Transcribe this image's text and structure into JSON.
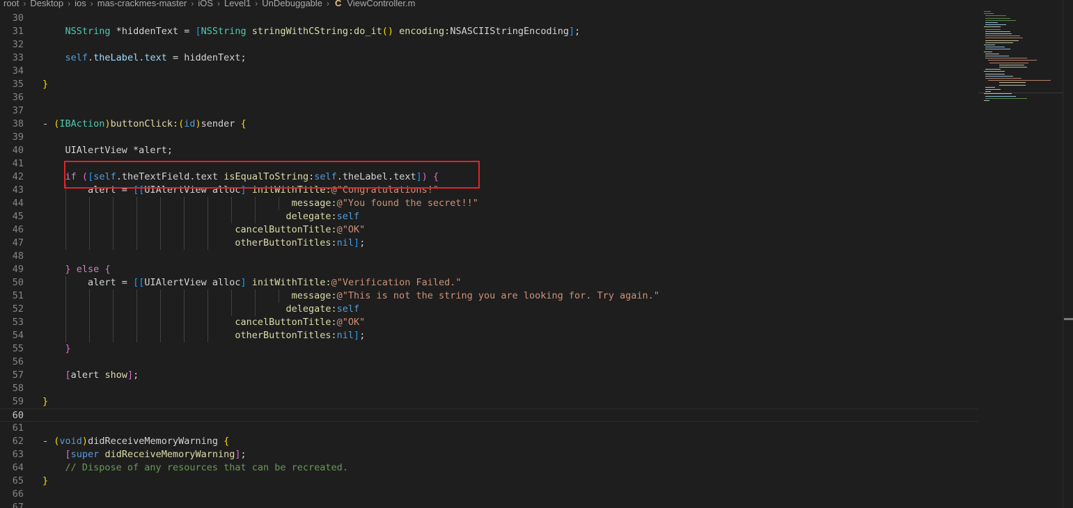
{
  "breadcrumb": {
    "items": [
      "root",
      "Desktop",
      "ios",
      "mas-crackmes-master",
      "iOS",
      "Level1",
      "UnDebuggable"
    ],
    "file_icon": "C",
    "file_name": "ViewController.m"
  },
  "editor": {
    "active_line": 60,
    "highlighted_lines": [
      42
    ],
    "lines": [
      {
        "n": 30,
        "tokens": []
      },
      {
        "n": 31,
        "tokens": [
          [
            "    ",
            ""
          ],
          [
            "NSString",
            "tk-type"
          ],
          [
            " *",
            ""
          ],
          [
            "hiddenText",
            ""
          ],
          [
            " = ",
            ""
          ],
          [
            "[",
            "tk-brk3"
          ],
          [
            "NSString",
            "tk-type"
          ],
          [
            " ",
            ""
          ],
          [
            "stringWithCString:",
            "tk-fn"
          ],
          [
            "do_it",
            "tk-fn"
          ],
          [
            "()",
            "tk-brk1"
          ],
          [
            " ",
            ""
          ],
          [
            "encoding:",
            "tk-fn"
          ],
          [
            "NSASCIIStringEncoding",
            ""
          ],
          [
            "]",
            "tk-brk3"
          ],
          [
            ";",
            ""
          ]
        ]
      },
      {
        "n": 32,
        "tokens": []
      },
      {
        "n": 33,
        "tokens": [
          [
            "    ",
            ""
          ],
          [
            "self",
            "tk-blue"
          ],
          [
            ".",
            ""
          ],
          [
            "theLabel",
            "tk-var"
          ],
          [
            ".",
            ""
          ],
          [
            "text",
            "tk-var"
          ],
          [
            " = hiddenText;",
            ""
          ]
        ]
      },
      {
        "n": 34,
        "tokens": []
      },
      {
        "n": 35,
        "tokens": [
          [
            "}",
            "tk-brk1"
          ]
        ]
      },
      {
        "n": 36,
        "tokens": []
      },
      {
        "n": 37,
        "tokens": []
      },
      {
        "n": 38,
        "tokens": [
          [
            "- ",
            ""
          ],
          [
            "(",
            "tk-brk1"
          ],
          [
            "IBAction",
            "tk-type"
          ],
          [
            ")",
            "tk-brk1"
          ],
          [
            "buttonClick:",
            "tk-fn"
          ],
          [
            "(",
            "tk-brk1"
          ],
          [
            "id",
            "tk-blue"
          ],
          [
            ")",
            "tk-brk1"
          ],
          [
            "sender",
            ""
          ],
          [
            " ",
            ""
          ],
          [
            "{",
            "tk-brk1"
          ]
        ]
      },
      {
        "n": 39,
        "tokens": []
      },
      {
        "n": 40,
        "tokens": [
          [
            "    ",
            ""
          ],
          [
            "UIAlertView",
            ""
          ],
          [
            " *alert;",
            ""
          ]
        ]
      },
      {
        "n": 41,
        "tokens": []
      },
      {
        "n": 42,
        "tokens": [
          [
            "    ",
            ""
          ],
          [
            "if",
            "tk-kw"
          ],
          [
            " ",
            ""
          ],
          [
            "(",
            "tk-brk2"
          ],
          [
            "[",
            "tk-brk3"
          ],
          [
            "self",
            "tk-blue"
          ],
          [
            ".",
            ""
          ],
          [
            "theTextField",
            ""
          ],
          [
            ".",
            ""
          ],
          [
            "text",
            ""
          ],
          [
            " ",
            ""
          ],
          [
            "isEqualToString:",
            "tk-fn"
          ],
          [
            "self",
            "tk-blue"
          ],
          [
            ".",
            ""
          ],
          [
            "theLabel",
            ""
          ],
          [
            ".",
            ""
          ],
          [
            "text",
            ""
          ],
          [
            "]",
            "tk-brk3"
          ],
          [
            ")",
            "tk-brk2"
          ],
          [
            " ",
            ""
          ],
          [
            "{",
            "tk-brk2"
          ]
        ]
      },
      {
        "n": 43,
        "tokens": [
          [
            "        ",
            ""
          ],
          [
            "alert",
            ""
          ],
          [
            " = ",
            ""
          ],
          [
            "[[",
            "tk-brk3"
          ],
          [
            "UIAlertView",
            ""
          ],
          [
            " alloc",
            ""
          ],
          [
            "]",
            "tk-brk3"
          ],
          [
            " ",
            ""
          ],
          [
            "initWithTitle:",
            "tk-fn"
          ],
          [
            "@\"Congratulations!\"",
            "tk-str"
          ]
        ]
      },
      {
        "n": 44,
        "tokens": [
          [
            "                                            ",
            ""
          ],
          [
            "message:",
            "tk-fn"
          ],
          [
            "@\"You found the secret!!\"",
            "tk-str"
          ]
        ]
      },
      {
        "n": 45,
        "tokens": [
          [
            "                                           ",
            ""
          ],
          [
            "delegate:",
            "tk-fn"
          ],
          [
            "self",
            "tk-blue"
          ]
        ]
      },
      {
        "n": 46,
        "tokens": [
          [
            "                                  ",
            ""
          ],
          [
            "cancelButtonTitle:",
            "tk-fn"
          ],
          [
            "@\"OK\"",
            "tk-str"
          ]
        ]
      },
      {
        "n": 47,
        "tokens": [
          [
            "                                  ",
            ""
          ],
          [
            "otherButtonTitles:",
            "tk-fn"
          ],
          [
            "nil",
            "tk-blue"
          ],
          [
            "]",
            "tk-brk3"
          ],
          [
            ";",
            ""
          ]
        ]
      },
      {
        "n": 48,
        "tokens": []
      },
      {
        "n": 49,
        "tokens": [
          [
            "    ",
            ""
          ],
          [
            "}",
            "tk-brk2"
          ],
          [
            " ",
            ""
          ],
          [
            "else",
            "tk-kw"
          ],
          [
            " ",
            ""
          ],
          [
            "{",
            "tk-brk2"
          ]
        ]
      },
      {
        "n": 50,
        "tokens": [
          [
            "        ",
            ""
          ],
          [
            "alert",
            ""
          ],
          [
            " = ",
            ""
          ],
          [
            "[[",
            "tk-brk3"
          ],
          [
            "UIAlertView",
            ""
          ],
          [
            " alloc",
            ""
          ],
          [
            "]",
            "tk-brk3"
          ],
          [
            " ",
            ""
          ],
          [
            "initWithTitle:",
            "tk-fn"
          ],
          [
            "@\"Verification Failed.\"",
            "tk-str"
          ]
        ]
      },
      {
        "n": 51,
        "tokens": [
          [
            "                                            ",
            ""
          ],
          [
            "message:",
            "tk-fn"
          ],
          [
            "@\"This is not the string you are looking for. Try again.\"",
            "tk-str"
          ]
        ]
      },
      {
        "n": 52,
        "tokens": [
          [
            "                                           ",
            ""
          ],
          [
            "delegate:",
            "tk-fn"
          ],
          [
            "self",
            "tk-blue"
          ]
        ]
      },
      {
        "n": 53,
        "tokens": [
          [
            "                                  ",
            ""
          ],
          [
            "cancelButtonTitle:",
            "tk-fn"
          ],
          [
            "@\"OK\"",
            "tk-str"
          ]
        ]
      },
      {
        "n": 54,
        "tokens": [
          [
            "                                  ",
            ""
          ],
          [
            "otherButtonTitles:",
            "tk-fn"
          ],
          [
            "nil",
            "tk-blue"
          ],
          [
            "]",
            "tk-brk3"
          ],
          [
            ";",
            ""
          ]
        ]
      },
      {
        "n": 55,
        "tokens": [
          [
            "    ",
            ""
          ],
          [
            "}",
            "tk-brk2"
          ]
        ]
      },
      {
        "n": 56,
        "tokens": []
      },
      {
        "n": 57,
        "tokens": [
          [
            "    ",
            ""
          ],
          [
            "[",
            "tk-brk2"
          ],
          [
            "alert",
            ""
          ],
          [
            " ",
            ""
          ],
          [
            "show",
            "tk-fn"
          ],
          [
            "]",
            "tk-brk2"
          ],
          [
            ";",
            ""
          ]
        ]
      },
      {
        "n": 58,
        "tokens": []
      },
      {
        "n": 59,
        "tokens": [
          [
            "}",
            "tk-brk1"
          ]
        ]
      },
      {
        "n": 60,
        "tokens": []
      },
      {
        "n": 61,
        "tokens": []
      },
      {
        "n": 62,
        "tokens": [
          [
            "- ",
            ""
          ],
          [
            "(",
            "tk-brk1"
          ],
          [
            "void",
            "tk-blue"
          ],
          [
            ")",
            "tk-brk1"
          ],
          [
            "didReceiveMemoryWarning",
            ""
          ],
          [
            " ",
            ""
          ],
          [
            "{",
            "tk-brk1"
          ]
        ]
      },
      {
        "n": 63,
        "tokens": [
          [
            "    ",
            ""
          ],
          [
            "[",
            "tk-brk2"
          ],
          [
            "super",
            "tk-blue"
          ],
          [
            " ",
            ""
          ],
          [
            "didReceiveMemoryWarning",
            "tk-fn"
          ],
          [
            "]",
            "tk-brk2"
          ],
          [
            ";",
            ""
          ]
        ]
      },
      {
        "n": 64,
        "tokens": [
          [
            "    ",
            ""
          ],
          [
            "// Dispose of any resources that can be recreated.",
            "tk-cmt"
          ]
        ]
      },
      {
        "n": 65,
        "tokens": [
          [
            "}",
            "tk-brk1"
          ]
        ]
      },
      {
        "n": 66,
        "tokens": []
      },
      {
        "n": 67,
        "tokens": []
      }
    ]
  },
  "colors": {
    "background": "#1e1e1e",
    "highlight_box": "#e0242a",
    "line_number": "#858585",
    "line_number_active": "#c6c6c6"
  }
}
